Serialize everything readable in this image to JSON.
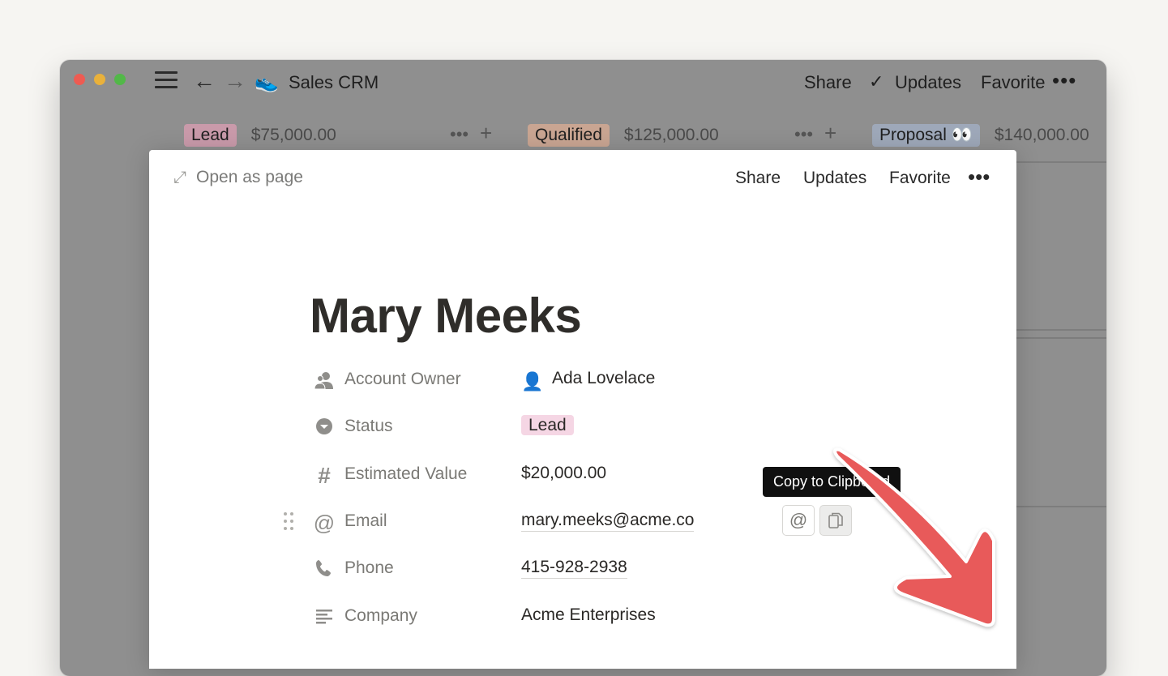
{
  "window": {
    "app_title": "Sales CRM",
    "app_icon": "shoe-icon",
    "toolbar": {
      "share": "Share",
      "updates": "Updates",
      "favorite": "Favorite",
      "more": "•••"
    }
  },
  "board": {
    "columns": [
      {
        "tag": "Lead",
        "amount": "$75,000.00",
        "color": "#c99aaa"
      },
      {
        "tag": "Qualified",
        "amount": "$125,000.00",
        "color": "#c9a592"
      },
      {
        "tag": "Proposal 👀",
        "amount": "$140,000.00",
        "color": "#9ea8b9"
      }
    ],
    "column_more": "•••",
    "column_add": "+"
  },
  "modal": {
    "open_as_page": "Open as page",
    "share": "Share",
    "updates": "Updates",
    "favorite": "Favorite",
    "more": "•••",
    "title": "Mary Meeks",
    "properties": [
      {
        "icon": "person-icon",
        "label": "Account Owner",
        "value": "Ada Lovelace"
      },
      {
        "icon": "status-icon",
        "label": "Status",
        "value": "Lead"
      },
      {
        "icon": "hash-icon",
        "label": "Estimated Value",
        "value": "$20,000.00"
      },
      {
        "icon": "at-icon",
        "label": "Email",
        "value": "mary.meeks@acme.co"
      },
      {
        "icon": "phone-icon",
        "label": "Phone",
        "value": "415-928-2938"
      },
      {
        "icon": "text-icon",
        "label": "Company",
        "value": "Acme Enterprises"
      }
    ],
    "tooltip": "Copy to Clipboard",
    "status_color": "#f5d6e4"
  },
  "colors": {
    "annotation_arrow": "#e85a5a",
    "window_overlay": "#8f8f8f"
  }
}
